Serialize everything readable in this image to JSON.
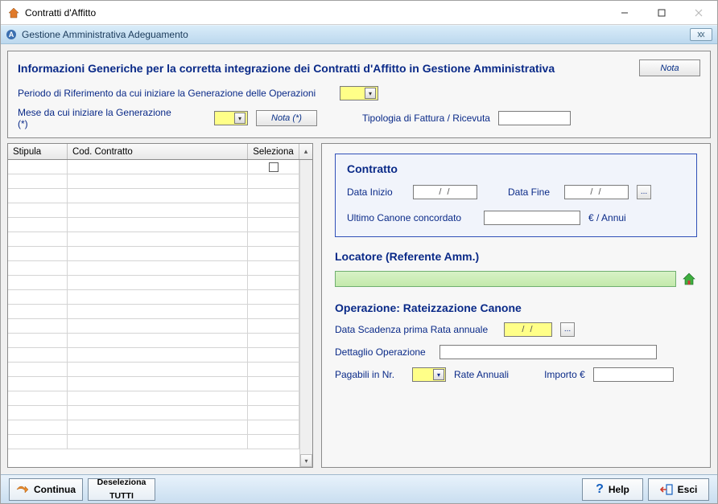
{
  "window": {
    "title": "Contratti d'Affitto"
  },
  "subheader": {
    "title": "Gestione Amministrativa Adeguamento"
  },
  "info": {
    "heading": "Informazioni Generiche per la corretta integrazione dei Contratti d'Affitto in Gestione Amministrativa",
    "nota_btn": "Nota",
    "periodo_label": "Periodo di Riferimento da cui iniziare la Generazione delle Operazioni",
    "mese_label": "Mese da cui iniziare la Generazione (*)",
    "nota_star_btn": "Nota (*)",
    "tipologia_label": "Tipologia di Fattura / Ricevuta",
    "periodo_value": "",
    "mese_value": "",
    "tipologia_value": ""
  },
  "grid": {
    "col_stipula": "Stipula",
    "col_cod": "Cod. Contratto",
    "col_sel": "Seleziona"
  },
  "contratto": {
    "group_title": "Contratto",
    "data_inizio_label": "Data Inizio",
    "data_inizio_value": "/   /",
    "data_fine_label": "Data Fine",
    "data_fine_value": "/   /",
    "ultimo_canone_label": "Ultimo Canone concordato",
    "ultimo_canone_value": "",
    "unit": "€ / Annui"
  },
  "locatore": {
    "title": "Locatore (Referente Amm.)",
    "value": ""
  },
  "operazione": {
    "title": "Operazione: Rateizzazione Canone",
    "data_scad_label": "Data Scadenza prima Rata annuale",
    "data_scad_value": "/ /",
    "dettaglio_label": "Dettaglio Operazione",
    "dettaglio_value": "",
    "pagabili_label": "Pagabili in Nr.",
    "pagabili_value": "",
    "rate_label": "Rate Annuali",
    "importo_label": "Importo €",
    "importo_value": ""
  },
  "footer": {
    "continua": "Continua",
    "deseleziona_line1": "Deseleziona",
    "deseleziona_line2": "TUTTI",
    "help": "Help",
    "esci": "Esci"
  }
}
